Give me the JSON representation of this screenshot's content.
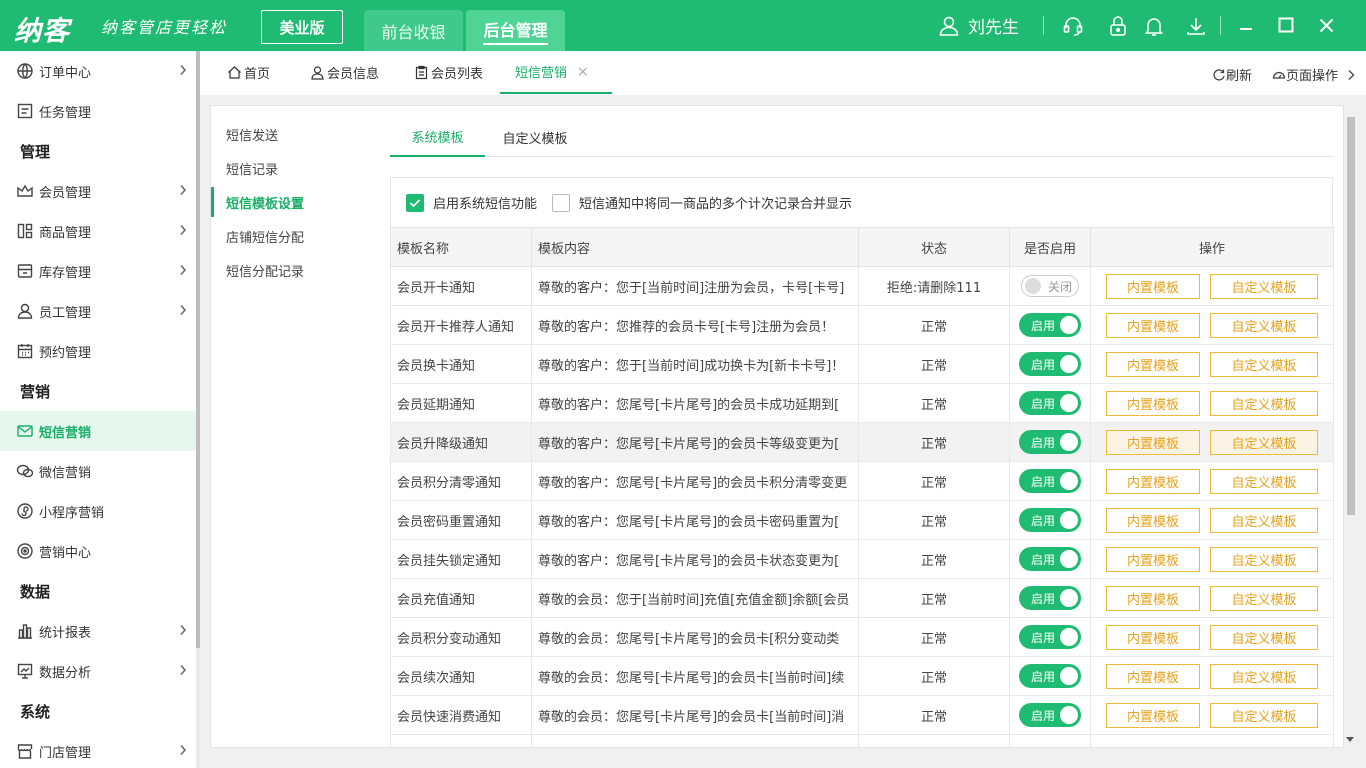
{
  "app": {
    "logo": "纳客",
    "slogan": "纳客管店更轻松",
    "edition": "美业版",
    "mode_front": "前台收银",
    "mode_back": "后台管理",
    "user_name": "刘先生"
  },
  "sidebar": {
    "items": [
      {
        "type": "item",
        "label": "订单中心",
        "icon": "order-icon",
        "arrow": true
      },
      {
        "type": "item",
        "label": "任务管理",
        "icon": "task-icon",
        "arrow": false
      },
      {
        "type": "group",
        "label": "管理"
      },
      {
        "type": "item",
        "label": "会员管理",
        "icon": "crown-icon",
        "arrow": true
      },
      {
        "type": "item",
        "label": "商品管理",
        "icon": "goods-icon",
        "arrow": true
      },
      {
        "type": "item",
        "label": "库存管理",
        "icon": "stock-icon",
        "arrow": true
      },
      {
        "type": "item",
        "label": "员工管理",
        "icon": "staff-icon",
        "arrow": true
      },
      {
        "type": "item",
        "label": "预约管理",
        "icon": "calendar-icon",
        "arrow": false
      },
      {
        "type": "group",
        "label": "营销"
      },
      {
        "type": "item",
        "label": "短信营销",
        "icon": "mail-icon",
        "arrow": false,
        "active": true
      },
      {
        "type": "item",
        "label": "微信营销",
        "icon": "wechat-icon",
        "arrow": false
      },
      {
        "type": "item",
        "label": "小程序营销",
        "icon": "miniprogram-icon",
        "arrow": false
      },
      {
        "type": "item",
        "label": "营销中心",
        "icon": "target-icon",
        "arrow": false
      },
      {
        "type": "group",
        "label": "数据"
      },
      {
        "type": "item",
        "label": "统计报表",
        "icon": "bar-chart-icon",
        "arrow": true
      },
      {
        "type": "item",
        "label": "数据分析",
        "icon": "analysis-icon",
        "arrow": true
      },
      {
        "type": "group",
        "label": "系统"
      },
      {
        "type": "item",
        "label": "门店管理",
        "icon": "store-icon",
        "arrow": true
      }
    ]
  },
  "page_tabs": {
    "home": "首页",
    "member_info": "会员信息",
    "member_list": "会员列表",
    "sms_marketing": "短信营销",
    "close": "×",
    "refresh": "刷新",
    "page_ops": "页面操作"
  },
  "left_menu": [
    "短信发送",
    "短信记录",
    "短信模板设置",
    "店铺短信分配",
    "短信分配记录"
  ],
  "left_menu_active": 2,
  "sub_tabs": {
    "system": "系统模板",
    "custom": "自定义模板"
  },
  "options": {
    "enable_sms": {
      "label": "启用系统短信功能",
      "checked": true
    },
    "merge_records": {
      "label": "短信通知中将同一商品的多个计次记录合并显示",
      "checked": false
    }
  },
  "table": {
    "headers": [
      "模板名称",
      "模板内容",
      "状态",
      "是否启用",
      "操作"
    ],
    "btn_builtin": "内置模板",
    "btn_custom": "自定义模板",
    "toggle_on": "启用",
    "toggle_off": "关闭",
    "rows": [
      {
        "name": "会员开卡通知",
        "content": "尊敬的客户：您于[当前时间]注册为会员，卡号[卡号]",
        "status": "拒绝:请删除111",
        "enabled": false
      },
      {
        "name": "会员开卡推荐人通知",
        "content": "尊敬的客户：您推荐的会员卡号[卡号]注册为会员！",
        "status": "正常",
        "enabled": true
      },
      {
        "name": "会员换卡通知",
        "content": "尊敬的客户：您于[当前时间]成功换卡为[新卡卡号]！",
        "status": "正常",
        "enabled": true
      },
      {
        "name": "会员延期通知",
        "content": "尊敬的客户：您尾号[卡片尾号]的会员卡成功延期到[",
        "status": "正常",
        "enabled": true
      },
      {
        "name": "会员升降级通知",
        "content": "尊敬的客户：您尾号[卡片尾号]的会员卡等级变更为[",
        "status": "正常",
        "enabled": true,
        "highlight": true
      },
      {
        "name": "会员积分清零通知",
        "content": "尊敬的客户：您尾号[卡片尾号]的会员卡积分清零变更",
        "status": "正常",
        "enabled": true
      },
      {
        "name": "会员密码重置通知",
        "content": "尊敬的客户：您尾号[卡片尾号]的会员卡密码重置为[",
        "status": "正常",
        "enabled": true
      },
      {
        "name": "会员挂失锁定通知",
        "content": "尊敬的客户：您尾号[卡片尾号]的会员卡状态变更为[",
        "status": "正常",
        "enabled": true
      },
      {
        "name": "会员充值通知",
        "content": "尊敬的会员：您于[当前时间]充值[充值金额]余额[会员",
        "status": "正常",
        "enabled": true
      },
      {
        "name": "会员积分变动通知",
        "content": "尊敬的会员：您尾号[卡片尾号]的会员卡[积分变动类",
        "status": "正常",
        "enabled": true
      },
      {
        "name": "会员续次通知",
        "content": "尊敬的会员：您尾号[卡片尾号]的会员卡[当前时间]续",
        "status": "正常",
        "enabled": true
      },
      {
        "name": "会员快速消费通知",
        "content": "尊敬的会员：您尾号[卡片尾号]的会员卡[当前时间]消",
        "status": "正常",
        "enabled": true
      },
      {
        "name": "",
        "content": "",
        "status": "",
        "enabled": null
      }
    ]
  },
  "colors": {
    "brand": "#20bb72",
    "accent_text": "#1aaf68",
    "warning": "#f0b93a"
  }
}
